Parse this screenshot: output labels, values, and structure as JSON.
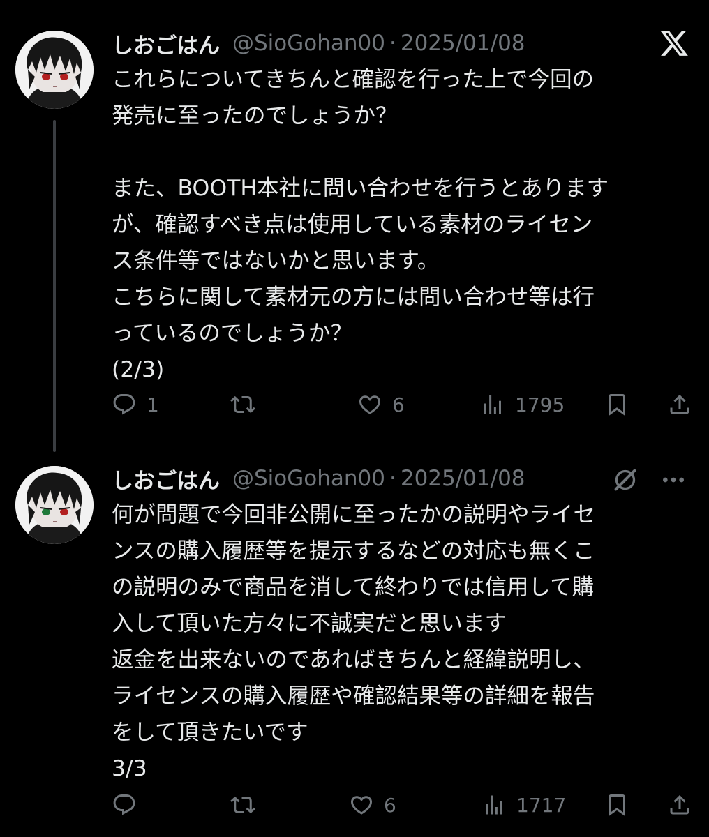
{
  "tweets": [
    {
      "display_name": "しおごはん",
      "handle": "@SioGohan00",
      "separator": "·",
      "date": "2025/01/08",
      "corner_icon": "x-logo-icon",
      "body": "これらについてきちんと確認を行った上で今回の\n発売に至ったのでしょうか？\n\nまた、BOOTH本社に問い合わせを行うとあります\nが、確認すべき点は使用している素材のライセン\nス条件等ではないかと思います。\nこちらに関して素材元の方には問い合わせ等は行\nっているのでしょうか？\n(2/3)",
      "actions": {
        "reply_count": "1",
        "repost_count": "",
        "like_count": "6",
        "views_count": "1795"
      }
    },
    {
      "display_name": "しおごはん",
      "handle": "@SioGohan00",
      "separator": "·",
      "date": "2025/01/08",
      "corner_icons": [
        "grok-icon",
        "more-icon"
      ],
      "body": "何が問題で今回非公開に至ったかの説明やライセ\nンスの購入履歴等を提示するなどの対応も無くこ\nの説明のみで商品を消して終わりでは信用して購\n入して頂いた方々に不誠実だと思います\n返金を出来ないのであればきちんと経緯説明し、\nライセンスの購入履歴や確認結果等の詳細を報告\nをして頂きたいです\n3/3",
      "actions": {
        "reply_count": "",
        "repost_count": "",
        "like_count": "6",
        "views_count": "1717"
      }
    }
  ],
  "colors": {
    "background": "#000000",
    "primary_text": "#e7e9ea",
    "secondary_text": "#71767b",
    "thread_line": "#3a3d41",
    "avatar_bg": "#f2f2f2"
  }
}
